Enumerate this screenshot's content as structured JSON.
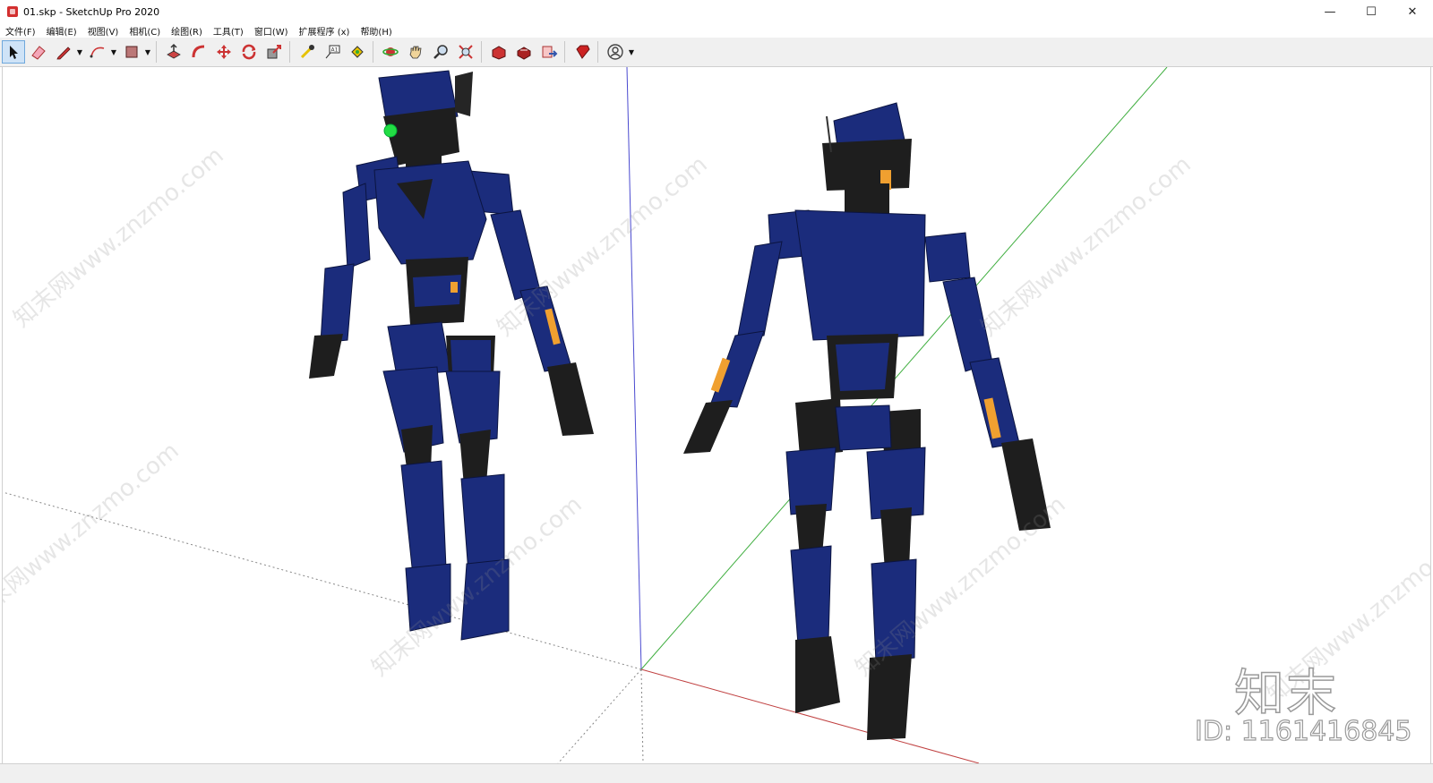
{
  "window": {
    "title": "01.skp - SketchUp Pro 2020",
    "minimize": "—",
    "maximize": "☐",
    "close": "✕"
  },
  "menu": {
    "items": [
      "文件(F)",
      "编辑(E)",
      "视图(V)",
      "相机(C)",
      "绘图(R)",
      "工具(T)",
      "窗口(W)",
      "扩展程序 (x)",
      "帮助(H)"
    ]
  },
  "toolbar": {
    "tools": [
      "select-icon",
      "eraser-icon",
      "pencil-icon",
      "arc-icon",
      "shape-icon",
      "push-pull-icon",
      "follow-me-icon",
      "move-icon",
      "rotate-icon",
      "scale-icon",
      "tape-measure-icon",
      "text-icon",
      "paint-bucket-icon",
      "orbit-icon",
      "pan-icon",
      "zoom-icon",
      "zoom-extents-icon",
      "warehouse-icon",
      "extension-warehouse-icon",
      "send-to-layout-icon",
      "ruby-icon",
      "account-icon"
    ]
  },
  "watermarks": {
    "text": "知末网www.znzmo.com"
  },
  "overlay": {
    "logo": "知末",
    "id": "ID: 1161416845"
  },
  "colors": {
    "robot_body": "#1b2c7c",
    "robot_dark": "#1e1e1e",
    "accent_orange": "#f0a030",
    "eye_green": "#22dd44",
    "axis_blue": "#4a4ad0",
    "axis_green": "#3fae3f",
    "axis_red": "#c04040"
  }
}
